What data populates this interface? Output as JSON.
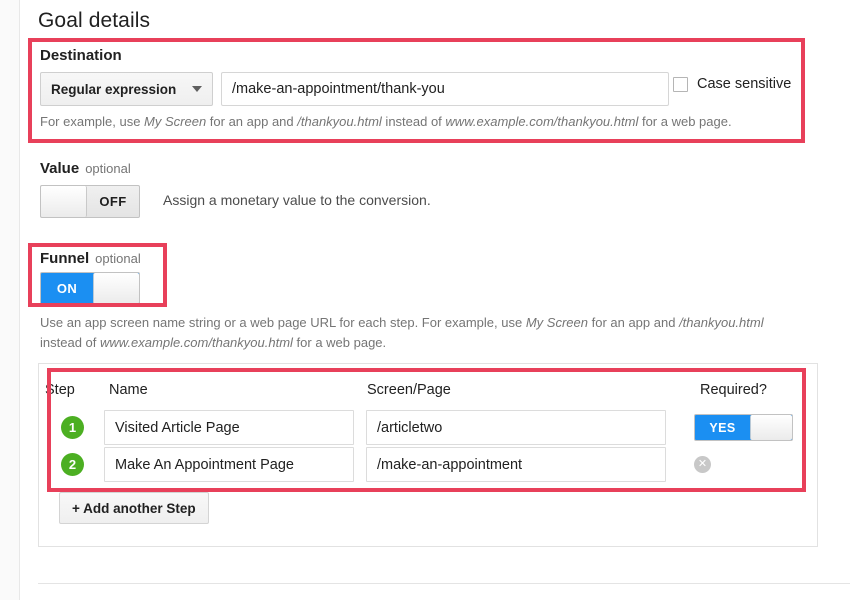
{
  "page": {
    "title": "Goal details"
  },
  "destination": {
    "label": "Destination",
    "match_type": "Regular expression",
    "caret_icon": "chevron-down-icon",
    "value": "/make-an-appointment/thank-you",
    "placeholder": "",
    "case_sensitive_label": "Case sensitive",
    "case_sensitive_checked": false,
    "help_prefix": "For example, use ",
    "help_em1": "My Screen",
    "help_mid1": " for an app and ",
    "help_em2": "/thankyou.html",
    "help_mid2": " instead of ",
    "help_em3": "www.example.com/thankyou.html",
    "help_suffix": " for a web page."
  },
  "value_section": {
    "label": "Value",
    "optional": "optional",
    "toggle_state": "OFF",
    "help": "Assign a monetary value to the conversion."
  },
  "funnel_section": {
    "label": "Funnel",
    "optional": "optional",
    "toggle_state": "ON",
    "help_prefix": "Use an app screen name string or a web page URL for each step. For example, use ",
    "help_em1": "My Screen",
    "help_mid1": " for an app and ",
    "help_em2": "/thankyou.html",
    "help_mid2": " instead of ",
    "help_em3": "www.example.com/thankyou.html",
    "help_suffix": " for a web page."
  },
  "steps_table": {
    "columns": {
      "step": "Step",
      "name": "Name",
      "screen": "Screen/Page",
      "required": "Required?"
    },
    "rows": [
      {
        "number": "1",
        "name": "Visited Article Page",
        "screen": "/articletwo",
        "required_toggle": "YES",
        "has_toggle": true,
        "has_remove": false
      },
      {
        "number": "2",
        "name": "Make An Appointment Page",
        "screen": "/make-an-appointment",
        "required_toggle": "",
        "has_toggle": false,
        "has_remove": true,
        "remove_icon": "remove-circle-icon"
      }
    ],
    "add_step_label": "+ Add another Step"
  },
  "annotations": {
    "highlight_color": "#e8405a",
    "boxes": [
      {
        "name": "destination-highlight"
      },
      {
        "name": "funnel-highlight"
      },
      {
        "name": "steps-highlight"
      }
    ]
  },
  "colors": {
    "toggle_on": "#1b8ff2",
    "step_badge": "#4caf22",
    "annotation": "#e8405a"
  }
}
